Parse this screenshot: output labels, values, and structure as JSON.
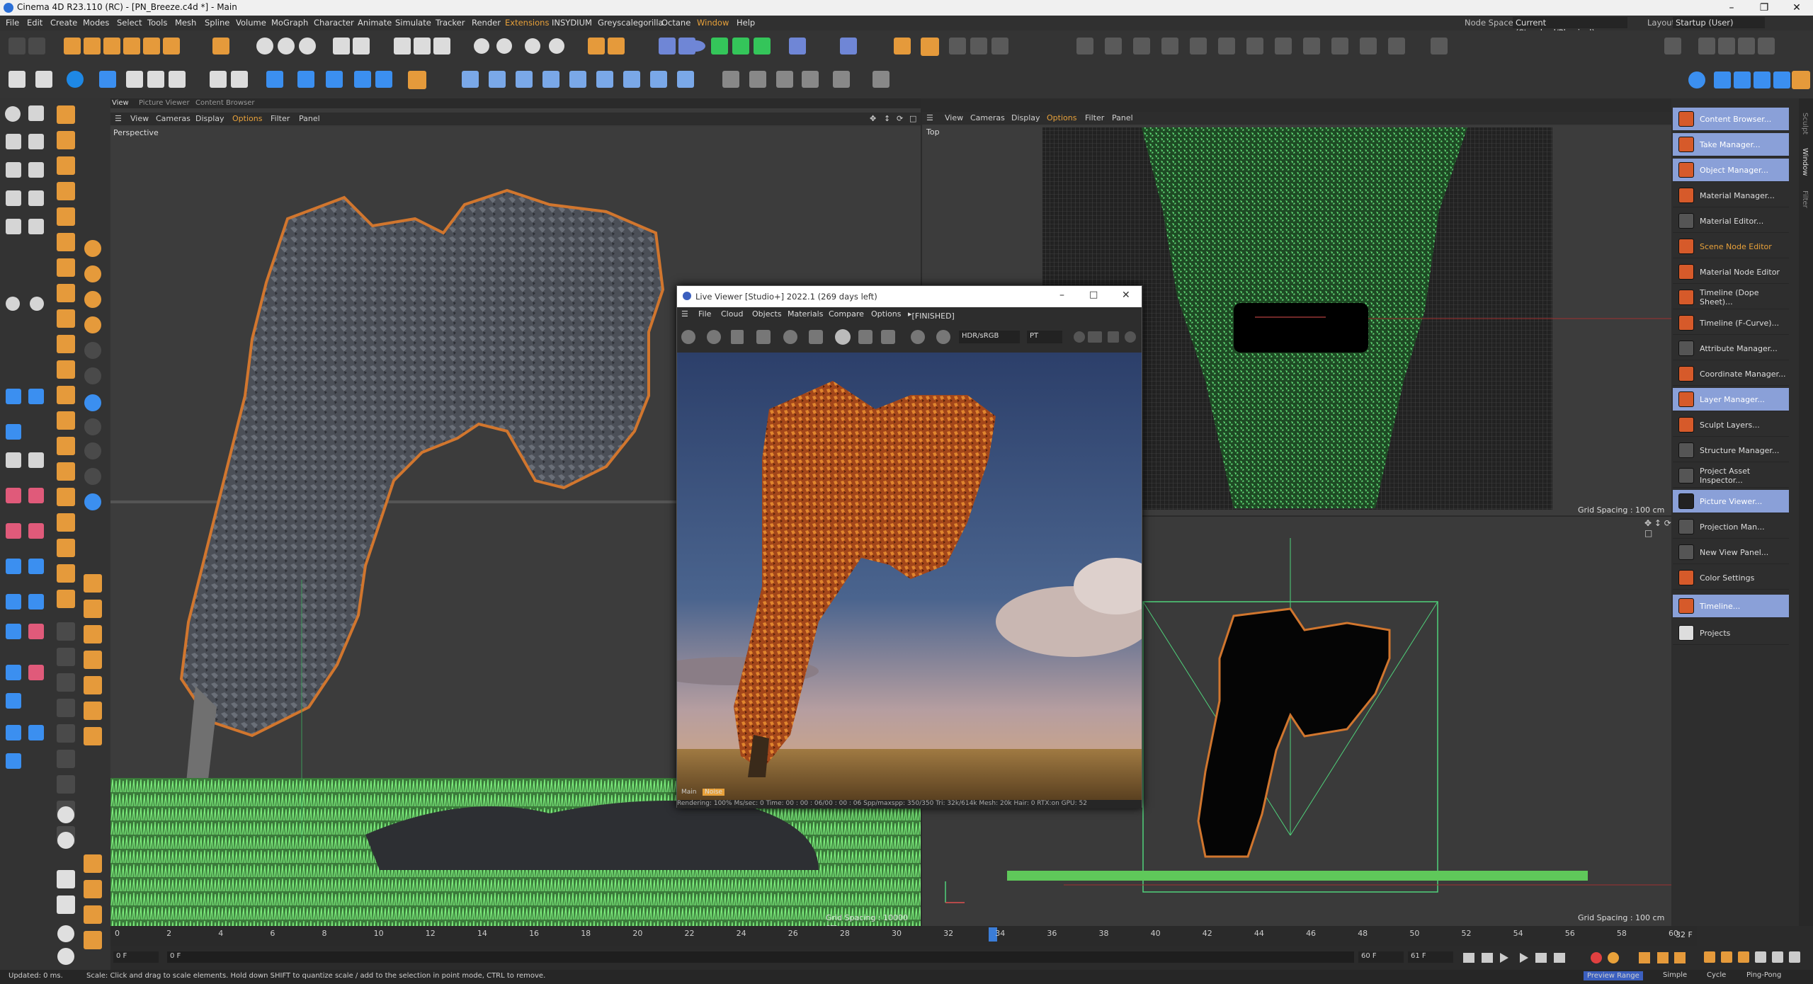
{
  "window": {
    "title": "Cinema 4D R23.110 (RC) - [PN_Breeze.c4d *] - Main"
  },
  "menu": [
    "File",
    "Edit",
    "Create",
    "Modes",
    "Select",
    "Tools",
    "Mesh",
    "Spline",
    "Volume",
    "MoGraph",
    "Character",
    "Animate",
    "Simulate",
    "Tracker",
    "Render",
    "Extensions",
    "INSYDIUM",
    "Greyscalegorilla",
    "Octane",
    "Window",
    "Help"
  ],
  "node_space": {
    "label": "Node Space:",
    "value": "Current (Standard/Physical)"
  },
  "layout": {
    "label": "Layout:",
    "value": "Startup (User)"
  },
  "left_viewport": {
    "tabs": [
      "View",
      "Picture Viewer",
      "Content Browser"
    ],
    "menu": [
      "View",
      "Cameras",
      "Display",
      "Options",
      "Filter",
      "Panel"
    ],
    "label": "Perspective",
    "grid_spacing": "Grid Spacing : 10000 cm"
  },
  "top_viewport": {
    "menu": [
      "View",
      "Cameras",
      "Display",
      "Options",
      "Filter",
      "Panel"
    ],
    "label": "Top",
    "grid_spacing": "Grid Spacing : 100 cm"
  },
  "right_viewport": {
    "grid_spacing": "Grid Spacing : 100 cm"
  },
  "live_viewer": {
    "title": "Live Viewer [Studio+] 2022.1 (269 days left)",
    "menu": [
      "File",
      "Cloud",
      "Objects",
      "Materials",
      "Compare",
      "Options",
      "[FINISHED]"
    ],
    "color_space": "HDR/sRGB",
    "kernel": "PT",
    "tabs": [
      "Main",
      "Noise"
    ],
    "status": "Rendering: 100%  Ms/sec: 0   Time: 00 : 00 : 06/00 : 00 : 06  Spp/maxspp: 350/350   Tri: 32k/614k   Mesh: 20k   Hair: 0   RTX:on      GPU:     52"
  },
  "right_panel": [
    {
      "label": "Content Browser...",
      "hl": true
    },
    {
      "label": "Take Manager...",
      "hl": true
    },
    {
      "label": "Object Manager...",
      "hl": true
    },
    {
      "label": "Material Manager...",
      "hl": false
    },
    {
      "label": "Material Editor...",
      "hl": false
    },
    {
      "label": "Scene Node Editor",
      "hl": false
    },
    {
      "label": "Material Node Editor",
      "hl": false
    },
    {
      "label": "Timeline (Dope Sheet)...",
      "hl": false
    },
    {
      "label": "Timeline (F-Curve)...",
      "hl": false
    },
    {
      "label": "Attribute Manager...",
      "hl": false
    },
    {
      "label": "Coordinate Manager...",
      "hl": false
    },
    {
      "label": "Layer Manager...",
      "hl": true
    },
    {
      "label": "Sculpt Layers...",
      "hl": false
    },
    {
      "label": "Structure Manager...",
      "hl": false
    },
    {
      "label": "Project Asset Inspector...",
      "hl": false
    },
    {
      "label": "Picture Viewer...",
      "hl": true
    },
    {
      "label": "Projection Man...",
      "hl": false
    },
    {
      "label": "New View Panel...",
      "hl": false
    },
    {
      "label": "Color Settings",
      "hl": false
    },
    {
      "label": "Timeline...",
      "hl": false
    },
    {
      "label": "Projects",
      "hl": false
    }
  ],
  "side_tabs": [
    "Sculpt",
    "Window",
    "Filter"
  ],
  "timeline": {
    "ticks": [
      "0",
      "2",
      "4",
      "6",
      "8",
      "10",
      "12",
      "14",
      "16",
      "18",
      "20",
      "22",
      "24",
      "26",
      "28",
      "30",
      "32",
      "34",
      "36",
      "38",
      "40",
      "42",
      "44",
      "46",
      "48",
      "50",
      "52",
      "54",
      "56",
      "58",
      "60"
    ],
    "current": "32 F",
    "start": "0 F",
    "field2": "0 F",
    "end": "60 F",
    "end2": "61 F"
  },
  "playback": {
    "preview_range": "Preview Range",
    "simple": "Simple",
    "cycle": "Cycle",
    "ping_pong": "Ping-Pong"
  },
  "status": {
    "updated": "Updated: 0 ms.",
    "hint": "Scale: Click and drag to scale elements. Hold down SHIFT to quantize scale / add to the selection in point mode, CTRL to remove."
  }
}
